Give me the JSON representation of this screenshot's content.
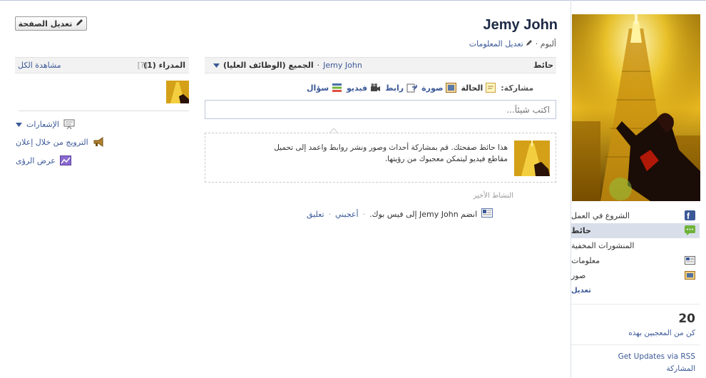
{
  "page": {
    "title": "Jemy John",
    "album_label": "ألبوم",
    "edit_info_label": "تعديل المعلومات",
    "edit_page_label": "تعديل الصفحة"
  },
  "sidebar": {
    "items": [
      {
        "label": "الشروع في العمل",
        "icon": "facebook-icon"
      },
      {
        "label": "حائط",
        "icon": "wall-icon",
        "active": true
      },
      {
        "label": "المنشورات المخفية",
        "icon": ""
      },
      {
        "label": "معلومات",
        "icon": "info-icon"
      },
      {
        "label": "صور",
        "icon": "photos-icon"
      }
    ],
    "edit_label": "تعديل",
    "likes_count": "20",
    "likes_label": "كن من المعجبين بهذه",
    "rss_label": "Get Updates via RSS",
    "share_label": "المشاركة"
  },
  "wall": {
    "title": "حائط",
    "filter_name": "Jemy John",
    "filter_label": "الجميع (الوظائف العليا)",
    "share_label": "مشاركة:",
    "share_options": [
      {
        "label": "الحالة",
        "icon": "status-icon"
      },
      {
        "label": "صورة",
        "icon": "photo-icon"
      },
      {
        "label": "رابط",
        "icon": "link-icon"
      },
      {
        "label": "فيديو",
        "icon": "video-icon"
      },
      {
        "label": "سؤال",
        "icon": "question-icon"
      }
    ],
    "post_placeholder": "اكتب شيئاً...",
    "notice_text": "هذا حائط صفحتك. قم بمشاركة أحداث وصور ونشر روابط واعمد إلى تحميل مقاطع فيديو ليتمكن معجبوك من رؤيتها.",
    "recent_title": "النشاط الأخير",
    "activity": {
      "name": "Jemy John",
      "text": "انضم Jemy John إلى فيس بوك.",
      "like_label": "أعجبني",
      "comment_label": "تعليق"
    }
  },
  "left": {
    "admins_title": "المدراء (1)",
    "help_label": "[?]",
    "see_all_label": "مشاهدة الكل",
    "items": [
      {
        "label": "الإشعارات",
        "icon": "notifications-icon"
      },
      {
        "label": "الترويج من خلال إعلان",
        "icon": "megaphone-icon"
      },
      {
        "label": "عرض الرؤى",
        "icon": "insights-icon"
      }
    ]
  },
  "colors": {
    "link": "#3b5998",
    "title": "#1c2a47",
    "nav_active": "#d8dfea"
  }
}
